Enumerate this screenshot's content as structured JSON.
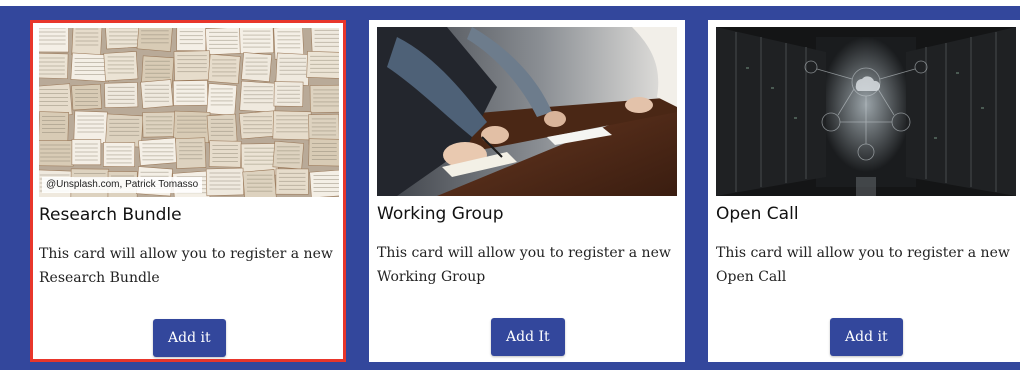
{
  "colors": {
    "frame_background": "#33479c",
    "card_background": "#ffffff",
    "button_background": "#33479c",
    "selected_border": "#e8362b"
  },
  "cards": [
    {
      "title": "Research Bundle",
      "description": "This card will allow you to register a new Research Bundle",
      "button_label": "Add it",
      "image": "books-collage-photo",
      "image_credit": "@Unsplash.com, Patrick Tomasso",
      "selected": true
    },
    {
      "title": "Working Group",
      "description": "This card will allow you to register a new Working Group",
      "button_label": "Add It",
      "image": "people-at-table-photo",
      "selected": false
    },
    {
      "title": "Open Call",
      "description": "This card will allow you to register a new Open Call",
      "button_label": "Add it",
      "image": "server-room-photo",
      "selected": false
    }
  ]
}
